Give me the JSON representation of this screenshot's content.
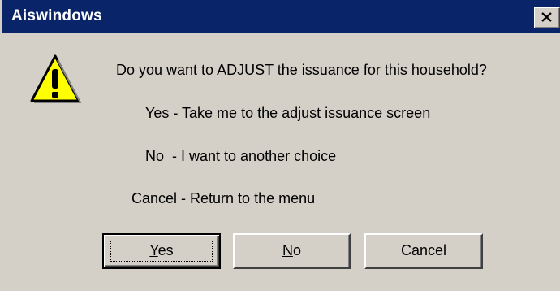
{
  "window": {
    "title": "Aiswindows",
    "close_icon": "close-x-icon"
  },
  "icon": {
    "name": "warning-icon",
    "colors": {
      "fill": "#ffff00",
      "outline": "#000000"
    }
  },
  "messages": {
    "question": "Do you want to ADJUST the issuance for this household?",
    "yes_line": "Yes - Take me to the adjust issuance screen",
    "no_line": "No  - I want to another choice",
    "cancel_line": "Cancel - Return to the menu"
  },
  "buttons": {
    "yes": {
      "mnemonic": "Y",
      "rest": "es"
    },
    "no": {
      "mnemonic": "N",
      "rest": "o"
    },
    "cancel": {
      "label": "Cancel"
    }
  },
  "colors": {
    "titlebar": "#0a246a",
    "face": "#d4d0c8"
  }
}
